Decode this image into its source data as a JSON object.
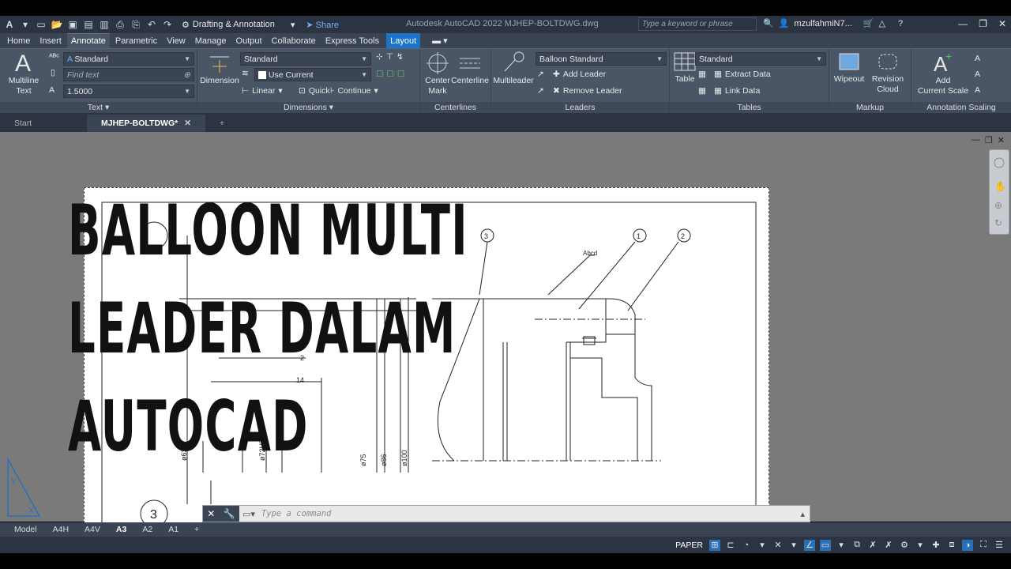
{
  "titlebar": {
    "workspace": "Drafting & Annotation",
    "share_label": "Share",
    "app_title": "Autodesk AutoCAD 2022   MJHEP-BOLTDWG.dwg",
    "search_placeholder": "Type a keyword or phrase",
    "username": "mzulfahmiN7..."
  },
  "ribbon_tabs": [
    "Home",
    "Insert",
    "Annotate",
    "Parametric",
    "View",
    "Manage",
    "Output",
    "Collaborate",
    "Express Tools",
    "Layout"
  ],
  "active_tab": "Annotate",
  "text_panel": {
    "multiline_text": "Multiline\nText",
    "text_style": "Standard",
    "find_text_placeholder": "Find text",
    "text_height": "1.5000",
    "title": "Text"
  },
  "dimensions_panel": {
    "dimension_label": "Dimension",
    "dim_style": "Standard",
    "layer": "Use Current",
    "linear": "Linear",
    "quick": "Quick",
    "continue": "Continue",
    "title": "Dimensions"
  },
  "centerlines_panel": {
    "center_mark": "Center\nMark",
    "centerline": "Centerline",
    "title": "Centerlines"
  },
  "leaders_panel": {
    "multileader": "Multileader",
    "mleader_style": "Balloon Standard",
    "add_leader": "Add Leader",
    "remove_leader": "Remove Leader",
    "title": "Leaders"
  },
  "tables_panel": {
    "table": "Table",
    "table_style": "Standard",
    "extract_data": "Extract Data",
    "link_data": "Link Data",
    "title": "Tables"
  },
  "markup_panel": {
    "wipeout": "Wipeout",
    "revision_cloud": "Revision\nCloud",
    "title": "Markup"
  },
  "scaling_panel": {
    "add_current_scale": "Add\nCurrent Scale",
    "title": "Annotation Scaling"
  },
  "file_tabs": [
    {
      "label": "Start",
      "active": false
    },
    {
      "label": "MJHEP-BOLTDWG*",
      "active": true
    }
  ],
  "overlay_title": [
    "BALLOON MULTI",
    "LEADER DALAM",
    "AUTOCAD"
  ],
  "drawing": {
    "balloons": [
      "3",
      "1",
      "2",
      "3"
    ],
    "note": "Abcd",
    "dims": [
      "2",
      "14",
      "ø63",
      "ø72H7",
      "ø75",
      "ø86",
      "ø100",
      "R0.5"
    ]
  },
  "command_line": {
    "placeholder": "Type a command"
  },
  "layout_tabs": [
    "Model",
    "A4H",
    "A4V",
    "A3",
    "A2",
    "A1",
    "+"
  ],
  "active_layout": "A3",
  "status": {
    "space": "PAPER"
  }
}
